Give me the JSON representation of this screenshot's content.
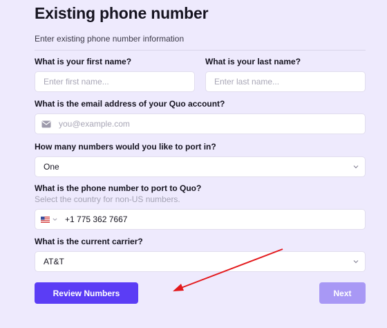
{
  "page": {
    "title": "Existing phone number",
    "subtitle": "Enter existing phone number information"
  },
  "form": {
    "first_name": {
      "label": "What is your first name?",
      "placeholder": "Enter first name..."
    },
    "last_name": {
      "label": "What is your last name?",
      "placeholder": "Enter last name..."
    },
    "email": {
      "label": "What is the email address of your Quo account?",
      "placeholder": "you@example.com",
      "icon": "mail-icon"
    },
    "numbers_count": {
      "label": "How many numbers would you like to port in?",
      "value": "One",
      "icon": "chevron-down-icon"
    },
    "phone": {
      "label": "What is the phone number to port to Quo?",
      "hint": "Select the country for non-US numbers.",
      "country_icon": "us-flag-icon",
      "value": "+1 775 362 7667"
    },
    "carrier": {
      "label": "What is the current carrier?",
      "value": "AT&T",
      "icon": "chevron-down-icon"
    }
  },
  "actions": {
    "review_label": "Review Numbers",
    "next_label": "Next",
    "primary_color": "#5b3df5",
    "disabled_color": "#a898f5"
  },
  "annotation": {
    "arrow_color": "#e3191c",
    "points_to": "review-numbers-button"
  }
}
